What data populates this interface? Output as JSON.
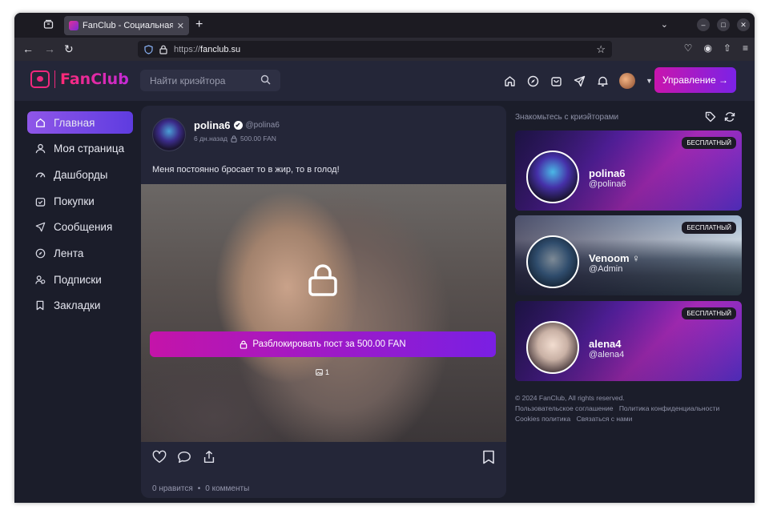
{
  "browser": {
    "tab_title": "FanClub - Социальная се",
    "url_prefix": "https://",
    "url_host": "fanclub.su"
  },
  "header": {
    "logo_text": "FanClub",
    "search_placeholder": "Найти криэйтора",
    "manage_button": "Управление →"
  },
  "sidebar": {
    "items": [
      {
        "label": "Главная",
        "icon": "home-icon"
      },
      {
        "label": "Моя страница",
        "icon": "user-icon"
      },
      {
        "label": "Дашборды",
        "icon": "dashboard-icon"
      },
      {
        "label": "Покупки",
        "icon": "bag-icon"
      },
      {
        "label": "Сообщения",
        "icon": "send-icon"
      },
      {
        "label": "Лента",
        "icon": "compass-icon"
      },
      {
        "label": "Подписки",
        "icon": "users-icon"
      },
      {
        "label": "Закладки",
        "icon": "bookmark-icon"
      }
    ]
  },
  "post": {
    "author": "polina6",
    "handle": "@polina6",
    "time": "6 дн.назад",
    "price": "500.00 FAN",
    "text": "Меня постоянно бросает то в жир, то в голод!",
    "unlock_label": "Разблокировать пост за 500.00 FAN",
    "media_count": "1",
    "likes": "0 нравится",
    "comments": "0 комменты"
  },
  "creators": {
    "title": "Знакомьтесь с криэйторами",
    "badge": "БЕСПЛАТНЫЙ",
    "list": [
      {
        "name": "polina6",
        "handle": "@polina6"
      },
      {
        "name": "Venoom ♀",
        "handle": "@Admin"
      },
      {
        "name": "alena4",
        "handle": "@alena4"
      }
    ]
  },
  "footer": {
    "copyright": "© 2024 FanClub, All rights reserved.",
    "links": [
      "Пользовательское соглашение",
      "Политика конфиденциальности",
      "Cookies политика",
      "Связаться с нами"
    ]
  },
  "colors": {
    "accent_gradient_start": "#c915ad",
    "accent_gradient_end": "#7b22e6",
    "brand_pink": "#f0287c",
    "app_bg": "#1b1d2a",
    "card_bg": "#242638"
  }
}
